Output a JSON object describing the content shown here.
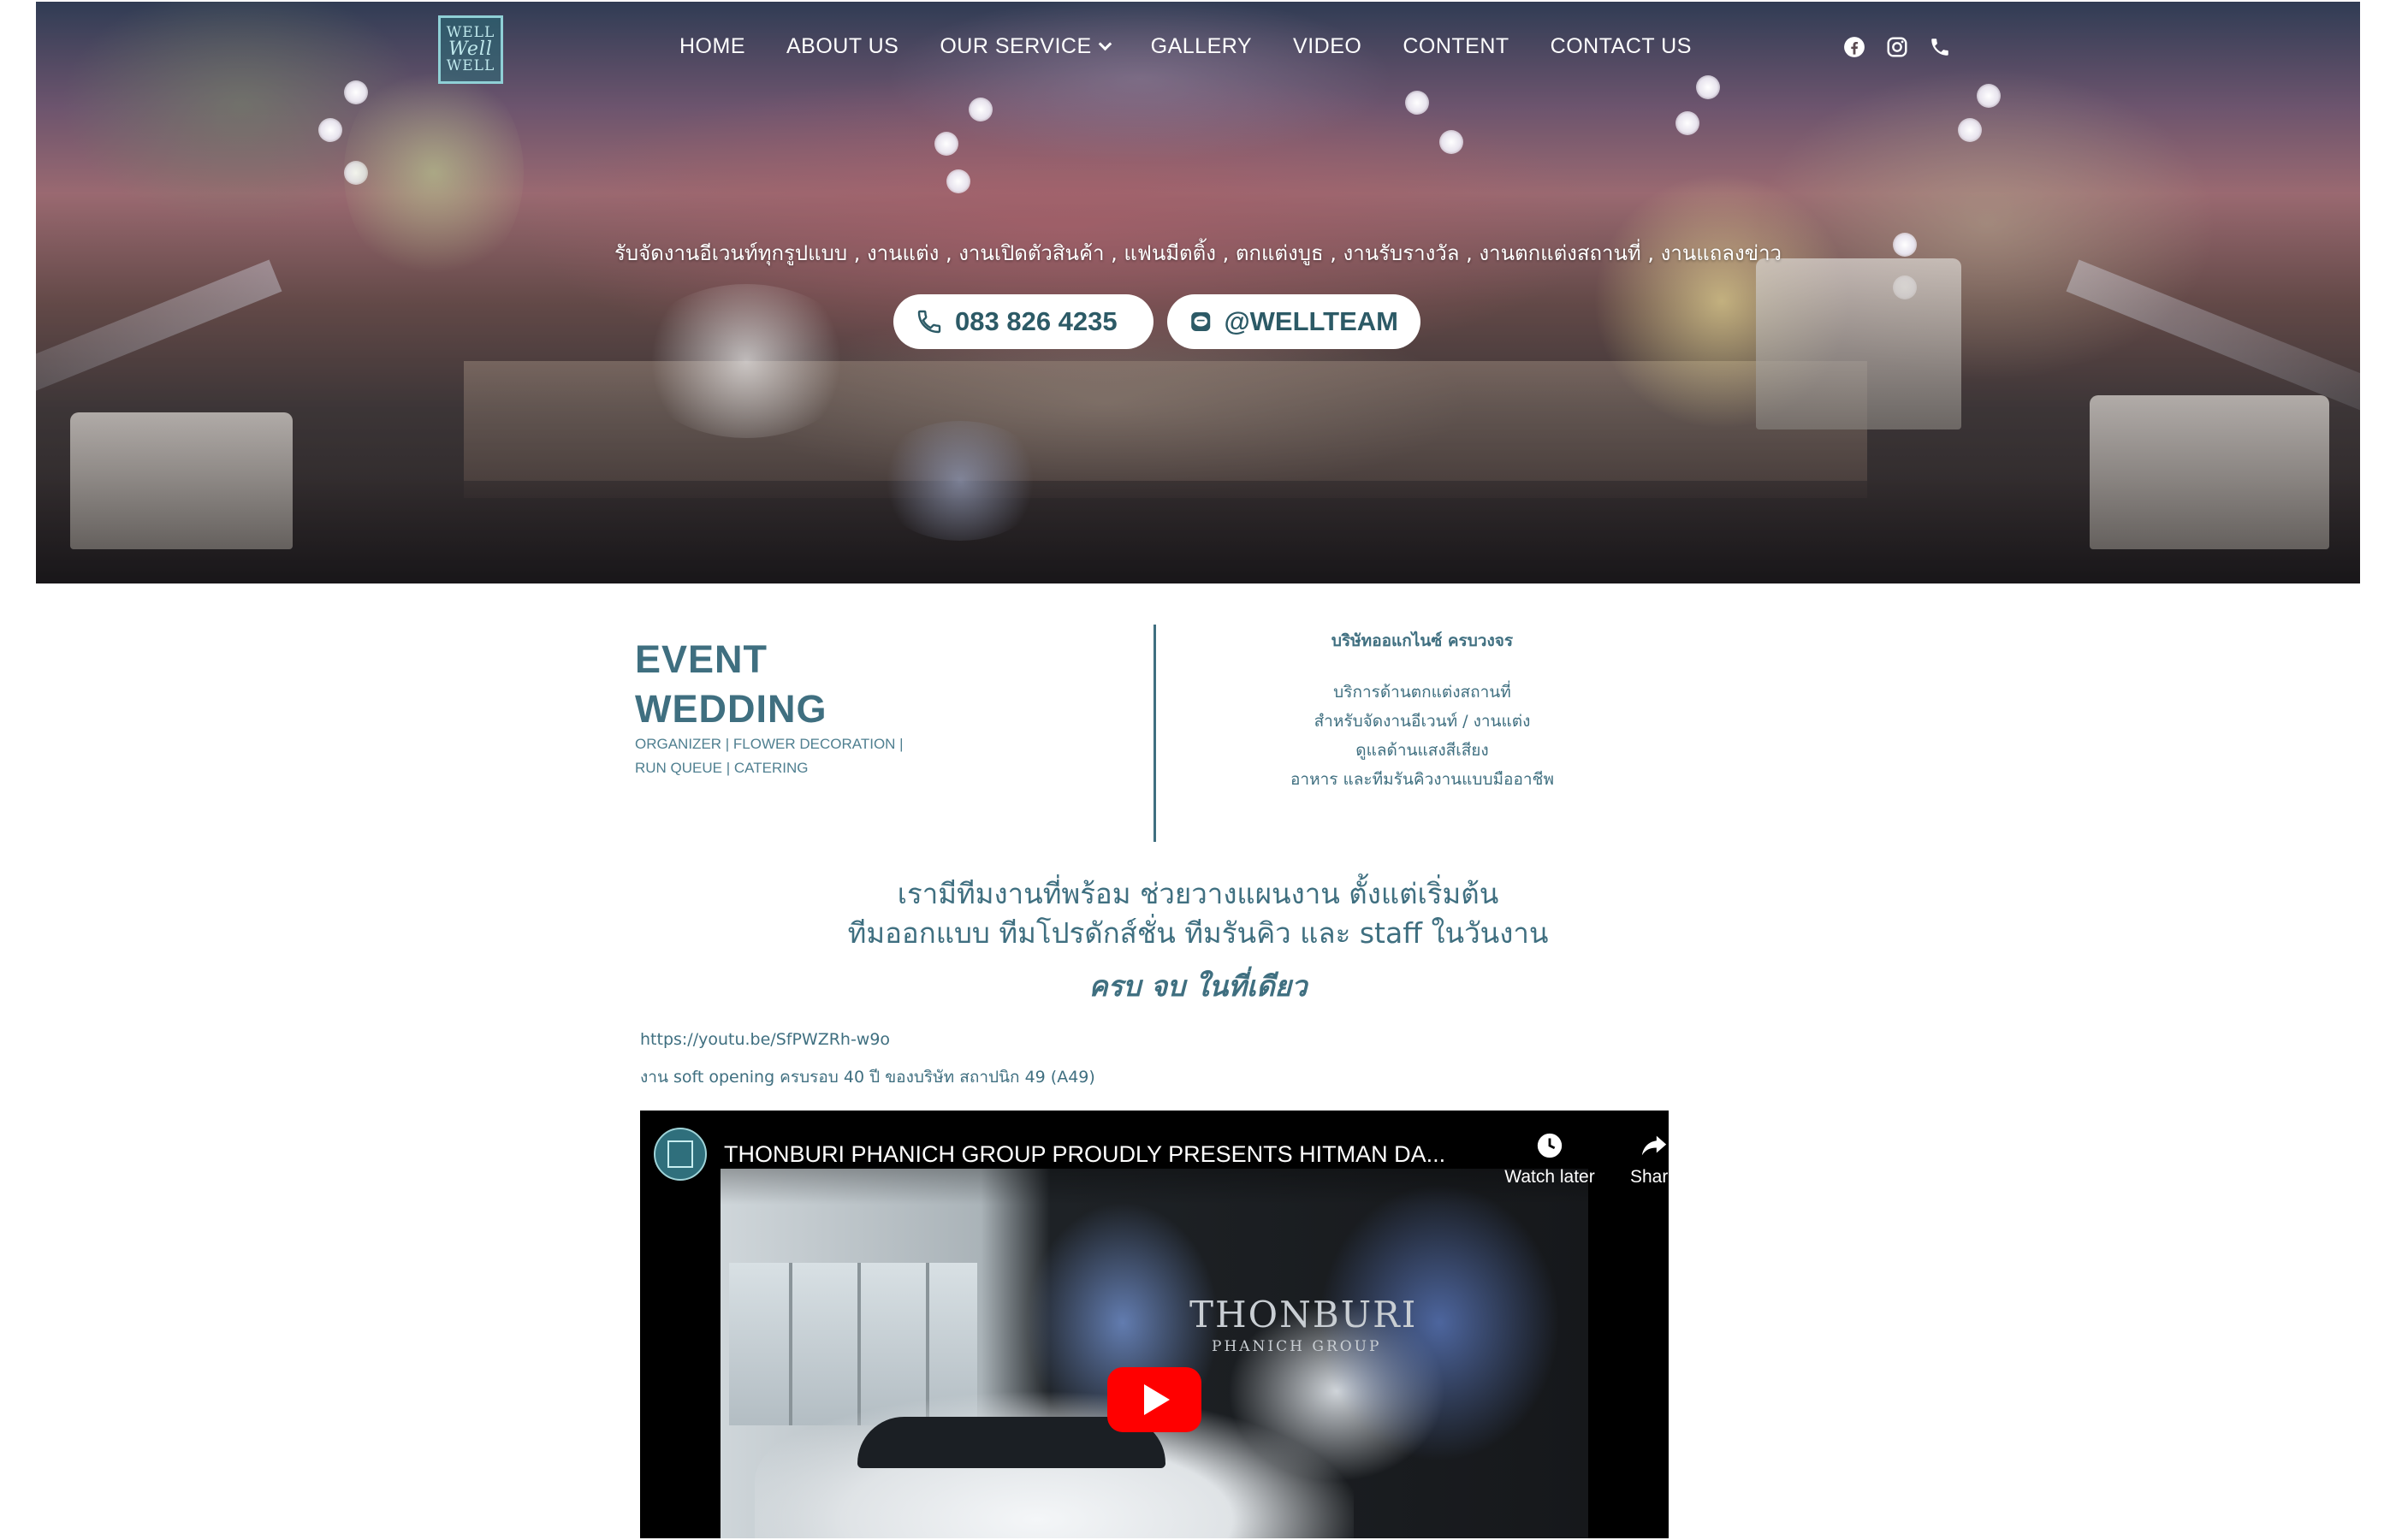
{
  "header": {
    "logo_alt": "Well Well Well",
    "logo_lines": [
      "WELL",
      "Well",
      "WELL"
    ],
    "nav": [
      {
        "label": "HOME"
      },
      {
        "label": "ABOUT US"
      },
      {
        "label": "OUR SERVICE",
        "has_dropdown": true
      },
      {
        "label": "GALLERY"
      },
      {
        "label": "VIDEO"
      },
      {
        "label": "CONTENT"
      },
      {
        "label": "CONTACT US"
      }
    ],
    "social_icons": [
      "facebook-icon",
      "instagram-icon",
      "phone-icon"
    ]
  },
  "hero": {
    "tagline": "รับจัดงานอีเวนท์ทุกรูปแบบ , งานแต่ง , งานเปิดตัวสินค้า , แฟนมีตติ้ง , ตกแต่งบูธ , งานรับรางวัล , งานตกแต่งสถานที่ , งานแถลงข่าว",
    "phone_label": "083 826 4235",
    "line_label": "@WELLTEAM",
    "button_text_color": "#2c5a66"
  },
  "intro": {
    "title_line1": "EVENT",
    "title_line2": "WEDDING",
    "subtitle_line1": "ORGANIZER | FLOWER DECORATION |",
    "subtitle_line2": "RUN QUEUE | CATERING",
    "company_heading": "บริษัทออแกไนซ์ ครบวงจร",
    "services": [
      "บริการด้านตกแต่งสถานที่",
      "สำหรับจัดงานอีเวนท์ / งานแต่ง",
      "ดูแลด้านแสงสีเสียง",
      "อาหาร และทีมรันคิวงานแบบมืออาชีพ"
    ],
    "accent_color": "#3f6f80"
  },
  "lead": {
    "line1": "เรามีทีมงานที่พร้อม ช่วยวางแผนงาน ตั้งแต่เริ่มต้น",
    "line2": "ทีมออกแบบ ทีมโปรดักส์ชั่น ทีมรันคิว และ staff ในวันงาน",
    "line3": "ครบ จบ ในที่เดียว"
  },
  "video_section": {
    "url_text": "https://youtu.be/SfPWZRh-w9o",
    "caption": "งาน soft opening ครบรอบ 40 ปี ของบริษัท สถาปนิก 49 (A49)",
    "video_title": "THONBURI PHANICH GROUP PROUDLY PRESENTS HITMAN DA...",
    "watch_later_label": "Watch later",
    "share_label": "Share",
    "thumbnail_brand": "THONBURI",
    "thumbnail_brand_sub": "PHANICH GROUP",
    "play_color": "#ff0000"
  }
}
